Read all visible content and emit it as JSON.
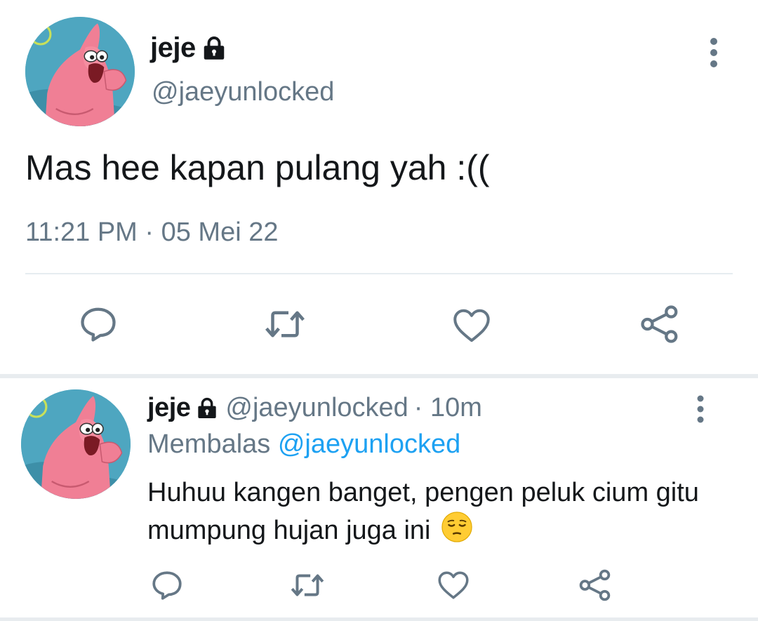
{
  "colors": {
    "text_primary": "#14171a",
    "text_secondary": "#657786",
    "link": "#1da1f2",
    "icon": "#657786",
    "divider": "#e6ecf0"
  },
  "main_tweet": {
    "display_name": "jeje",
    "handle": "@jaeyunlocked",
    "text": "Mas hee kapan pulang yah :((",
    "timestamp": "11:21 PM · 05 Mei 22",
    "icons": {
      "lock": "lock-icon",
      "more": "more-vertical-icon",
      "reply": "reply-bubble-icon",
      "retweet": "retweet-icon",
      "like": "heart-icon",
      "share": "share-icon"
    }
  },
  "reply_tweet": {
    "display_name": "jeje",
    "handle": "@jaeyunlocked",
    "time_ago": "· 10m",
    "replying_label": "Membalas",
    "replying_to": "@jaeyunlocked",
    "text": "Huhuu kangen banget, pengen peluk cium gitu mumpung hujan juga ini",
    "emoji": "pensive-face"
  }
}
